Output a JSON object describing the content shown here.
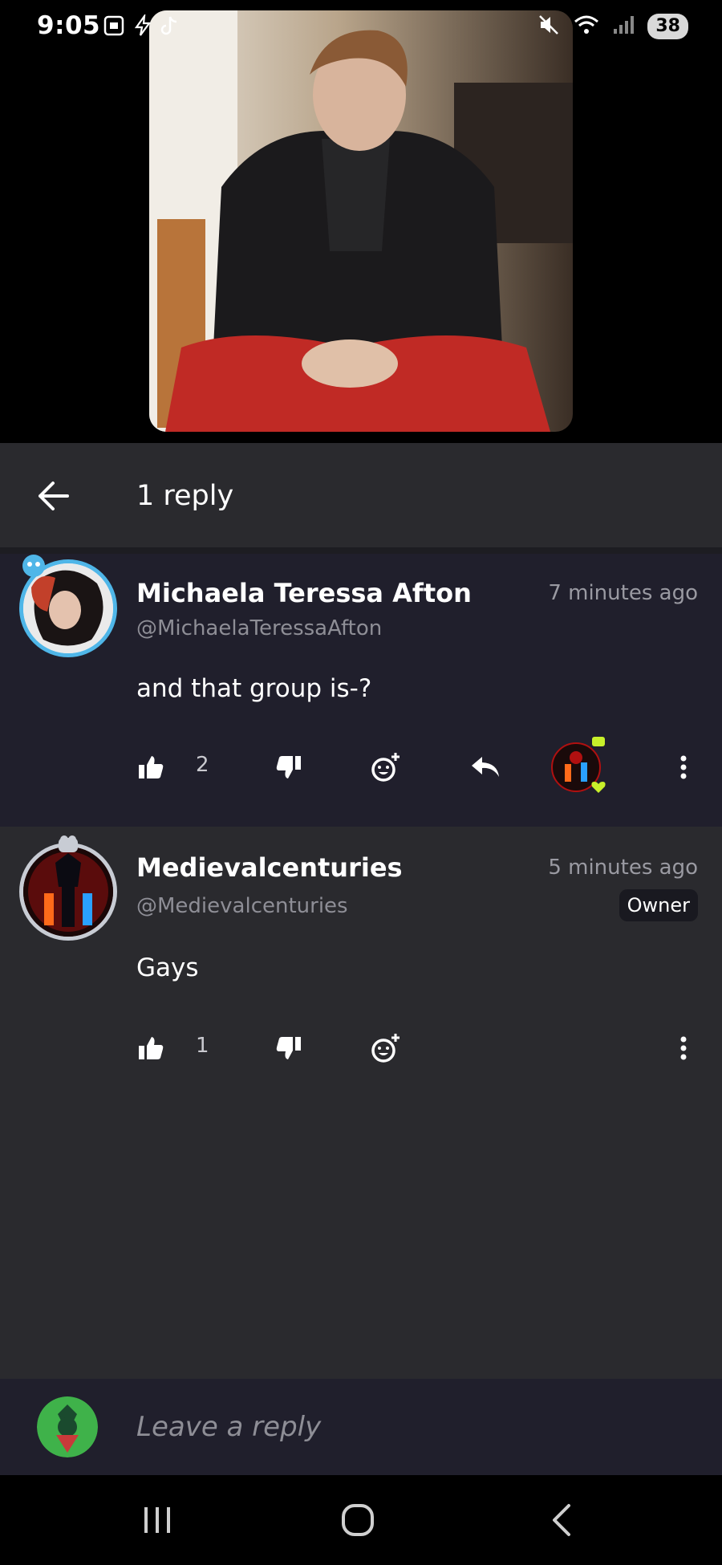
{
  "status_bar": {
    "time": "9:05",
    "battery": "38",
    "left_icons": [
      "screenshot-icon",
      "flash-icon",
      "tiktok-icon"
    ],
    "right_icons": [
      "mute-icon",
      "wifi-icon",
      "signal-icon"
    ]
  },
  "header": {
    "title": "1 reply",
    "back_icon": "arrow-left-icon"
  },
  "comments": [
    {
      "author": "Michaela Teressa Afton",
      "handle": "@MichaelaTeressaAfton",
      "time": "7 minutes ago",
      "text": "and that group is-?",
      "likes": "2",
      "badge": ""
    },
    {
      "author": "Medievalcenturies",
      "handle": "@Medievalcenturies",
      "time": "5 minutes ago",
      "text": "Gays",
      "likes": "1",
      "badge": "Owner"
    }
  ],
  "reply_bar": {
    "placeholder": "Leave a reply"
  },
  "colors": {
    "accent_ring": "#4fb6e8",
    "header_bg": "#2a2a2e",
    "comment_bg": "#201f2c",
    "text_muted": "#8e8e96"
  }
}
